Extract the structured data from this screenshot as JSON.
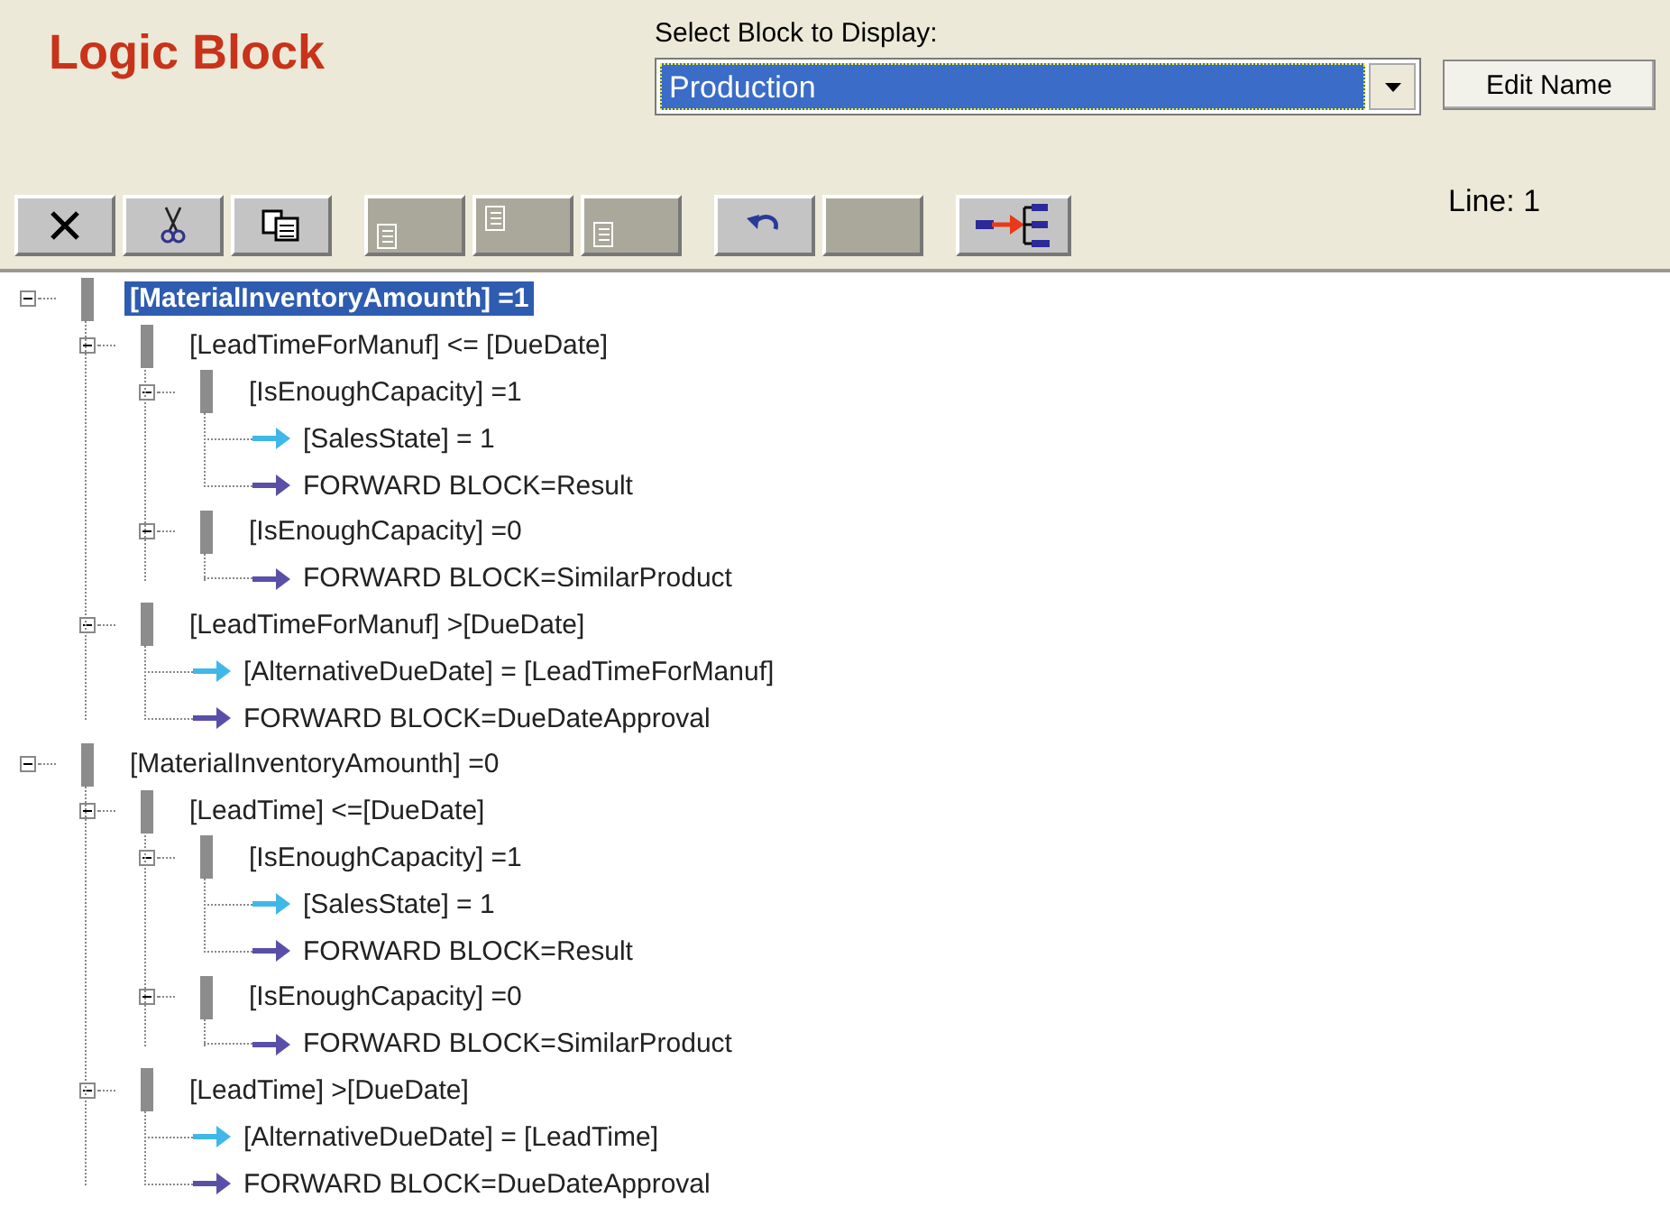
{
  "title": "Logic Block",
  "block_select": {
    "label": "Select Block to Display:",
    "value": "Production"
  },
  "edit_button": "Edit Name",
  "toolbar": [
    {
      "kind": "delete",
      "disabled": false
    },
    {
      "kind": "cut",
      "disabled": false
    },
    {
      "kind": "copy",
      "disabled": false
    },
    {
      "kind": "paste-before",
      "disabled": true
    },
    {
      "kind": "paste-child",
      "disabled": true
    },
    {
      "kind": "paste-after",
      "disabled": true
    },
    {
      "kind": "undo",
      "disabled": false
    },
    {
      "kind": "blank",
      "disabled": true
    },
    {
      "kind": "link",
      "disabled": false
    }
  ],
  "line_indicator": "Line: 1",
  "tree": [
    {
      "kind": "condition",
      "text": "[MaterialInventoryAmounth] =1",
      "selected": true,
      "expanded": true,
      "children": [
        {
          "kind": "condition",
          "text": "[LeadTimeForManuf] <= [DueDate]",
          "selected": false,
          "expanded": true,
          "children": [
            {
              "kind": "condition",
              "text": "[IsEnoughCapacity] =1",
              "selected": false,
              "expanded": true,
              "children": [
                {
                  "kind": "assign",
                  "text": "[SalesState] = 1"
                },
                {
                  "kind": "forward",
                  "text": "FORWARD BLOCK=Result"
                }
              ]
            },
            {
              "kind": "condition",
              "text": "[IsEnoughCapacity] =0",
              "selected": false,
              "expanded": true,
              "children": [
                {
                  "kind": "forward",
                  "text": "FORWARD BLOCK=SimilarProduct"
                }
              ]
            }
          ]
        },
        {
          "kind": "condition",
          "text": "[LeadTimeForManuf] >[DueDate]",
          "selected": false,
          "expanded": true,
          "children": [
            {
              "kind": "assign",
              "text": "[AlternativeDueDate] = [LeadTimeForManuf]"
            },
            {
              "kind": "forward",
              "text": "FORWARD BLOCK=DueDateApproval"
            }
          ]
        }
      ]
    },
    {
      "kind": "condition",
      "text": "[MaterialInventoryAmounth] =0",
      "selected": false,
      "expanded": true,
      "children": [
        {
          "kind": "condition",
          "text": "[LeadTime] <=[DueDate]",
          "selected": false,
          "expanded": true,
          "children": [
            {
              "kind": "condition",
              "text": "[IsEnoughCapacity] =1",
              "selected": false,
              "expanded": true,
              "children": [
                {
                  "kind": "assign",
                  "text": "[SalesState] = 1"
                },
                {
                  "kind": "forward",
                  "text": "FORWARD BLOCK=Result"
                }
              ]
            },
            {
              "kind": "condition",
              "text": "[IsEnoughCapacity] =0",
              "selected": false,
              "expanded": true,
              "children": [
                {
                  "kind": "forward",
                  "text": "FORWARD BLOCK=SimilarProduct"
                }
              ]
            }
          ]
        },
        {
          "kind": "condition",
          "text": "[LeadTime] >[DueDate]",
          "selected": false,
          "expanded": true,
          "children": [
            {
              "kind": "assign",
              "text": "[AlternativeDueDate] = [LeadTime]"
            },
            {
              "kind": "forward",
              "text": "FORWARD BLOCK=DueDateApproval"
            }
          ]
        }
      ]
    }
  ]
}
